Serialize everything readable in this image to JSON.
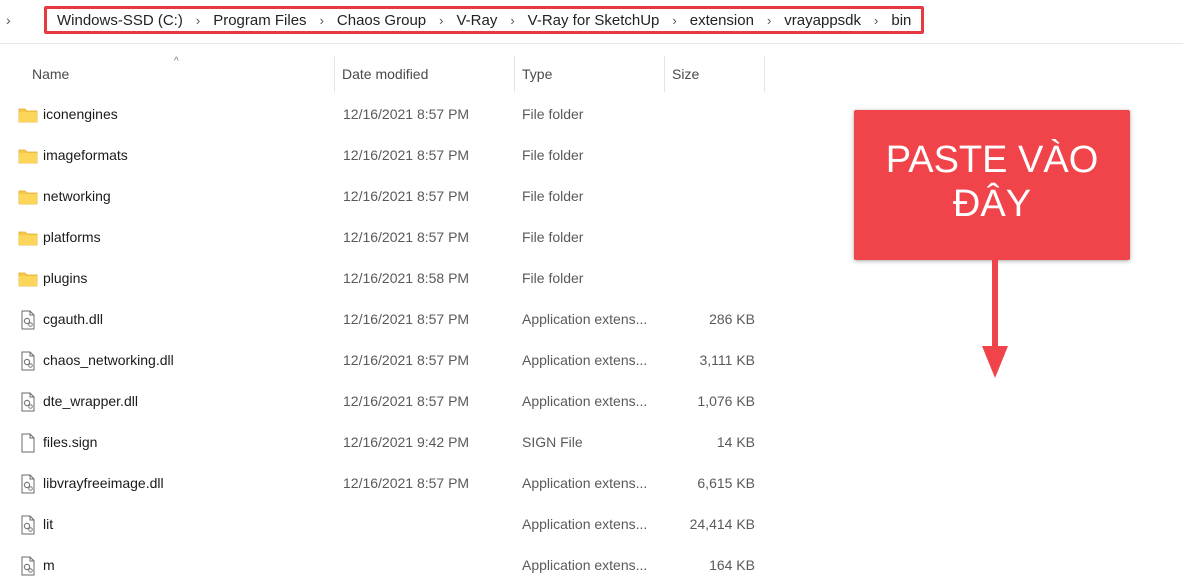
{
  "address_bar": {
    "lead_chevron": "›",
    "crumbs": [
      "Windows-SSD (C:)",
      "Program Files",
      "Chaos Group",
      "V-Ray",
      "V-Ray for SketchUp",
      "extension",
      "vrayappsdk",
      "bin"
    ]
  },
  "columns": {
    "name": "Name",
    "date": "Date modified",
    "type": "Type",
    "size": "Size"
  },
  "sort_indicator": "^",
  "files": [
    {
      "name": "iconengines",
      "date": "12/16/2021 8:57 PM",
      "type": "File folder",
      "size": "",
      "icon": "folder-icon"
    },
    {
      "name": "imageformats",
      "date": "12/16/2021 8:57 PM",
      "type": "File folder",
      "size": "",
      "icon": "folder-icon"
    },
    {
      "name": "networking",
      "date": "12/16/2021 8:57 PM",
      "type": "File folder",
      "size": "",
      "icon": "folder-icon"
    },
    {
      "name": "platforms",
      "date": "12/16/2021 8:57 PM",
      "type": "File folder",
      "size": "",
      "icon": "folder-icon"
    },
    {
      "name": "plugins",
      "date": "12/16/2021 8:58 PM",
      "type": "File folder",
      "size": "",
      "icon": "folder-icon"
    },
    {
      "name": "cgauth.dll",
      "date": "12/16/2021 8:57 PM",
      "type": "Application extens...",
      "size": "286 KB",
      "icon": "dll-file-icon"
    },
    {
      "name": "chaos_networking.dll",
      "date": "12/16/2021 8:57 PM",
      "type": "Application extens...",
      "size": "3,111 KB",
      "icon": "dll-file-icon"
    },
    {
      "name": "dte_wrapper.dll",
      "date": "12/16/2021 8:57 PM",
      "type": "Application extens...",
      "size": "1,076 KB",
      "icon": "dll-file-icon"
    },
    {
      "name": "files.sign",
      "date": "12/16/2021 9:42 PM",
      "type": "SIGN File",
      "size": "14 KB",
      "icon": "file-icon"
    },
    {
      "name": "libvrayfreeimage.dll",
      "date": "12/16/2021 8:57 PM",
      "type": "Application extens...",
      "size": "6,615 KB",
      "icon": "dll-file-icon"
    },
    {
      "name": "lit",
      "date": "",
      "type": "Application extens...",
      "size": "24,414 KB",
      "icon": "dll-file-icon"
    },
    {
      "name": "m",
      "date": "",
      "type": "Application extens...",
      "size": "164 KB",
      "icon": "dll-file-icon"
    }
  ],
  "callout": {
    "line1": "PASTE VÀO",
    "line2": "ĐÂY"
  },
  "colors": {
    "accent_red": "#f0434a",
    "border_red": "#e63a40",
    "folder_yellow": "#f7c948"
  }
}
